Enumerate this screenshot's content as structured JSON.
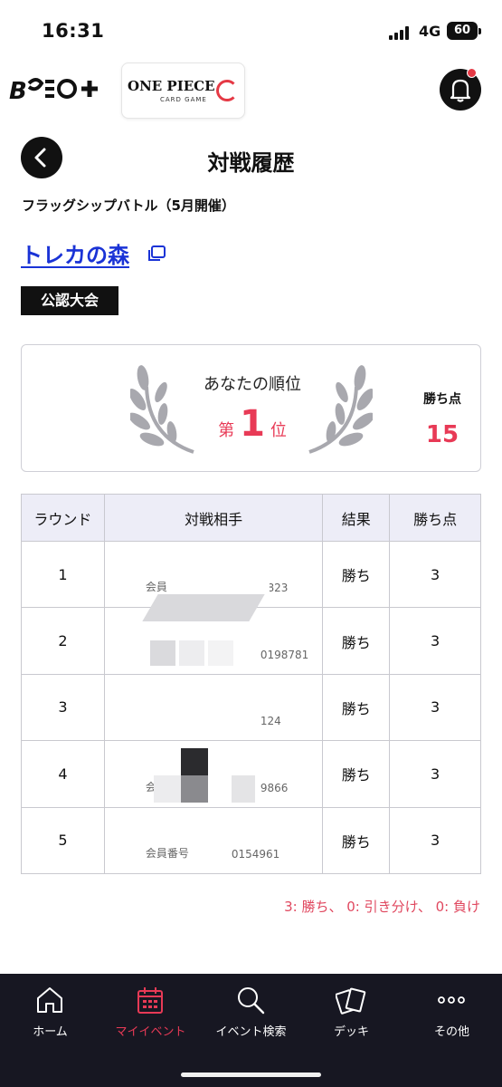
{
  "status": {
    "time": "16:31",
    "network": "4G",
    "battery": "60"
  },
  "header": {
    "bandai_logo": "B",
    "op_logo_title": "ONE PIECE",
    "op_logo_sub": "CARD GAME"
  },
  "page": {
    "title": "対戦履歴",
    "event_name": "フラッグシップバトル（5月開催）",
    "store_name": "トレカの森",
    "tag": "公認大会"
  },
  "rank": {
    "label": "あなたの順位",
    "prefix": "第",
    "number": "1",
    "suffix": "位",
    "points_label": "勝ち点",
    "points_value": "15"
  },
  "table": {
    "headers": [
      "ラウンド",
      "対戦相手",
      "結果",
      "勝ち点"
    ],
    "rows": [
      {
        "round": "1",
        "member_prefix": "会員",
        "member_suffix": "5823",
        "result": "勝ち",
        "points": "3"
      },
      {
        "round": "2",
        "member_prefix": "",
        "member_suffix": "0198781",
        "result": "勝ち",
        "points": "3"
      },
      {
        "round": "3",
        "member_prefix": "",
        "member_suffix": "124",
        "result": "勝ち",
        "points": "3"
      },
      {
        "round": "4",
        "member_prefix": "会員",
        "member_suffix": "9866",
        "result": "勝ち",
        "points": "3"
      },
      {
        "round": "5",
        "member_prefix": "会員番号",
        "member_suffix": "0154961",
        "result": "勝ち",
        "points": "3"
      }
    ]
  },
  "legend": "3: 勝ち、 0: 引き分け、 0: 負け",
  "nav": {
    "items": [
      {
        "label": "ホーム",
        "icon": "home-icon"
      },
      {
        "label": "マイイベント",
        "icon": "calendar-icon"
      },
      {
        "label": "イベント検索",
        "icon": "search-icon"
      },
      {
        "label": "デッキ",
        "icon": "cards-icon"
      },
      {
        "label": "その他",
        "icon": "more-icon"
      }
    ],
    "active_index": 1
  },
  "colors": {
    "accent": "#e83a56",
    "link": "#1a33d6",
    "nav_bg": "#171722",
    "header_bg": "#ededf7"
  }
}
